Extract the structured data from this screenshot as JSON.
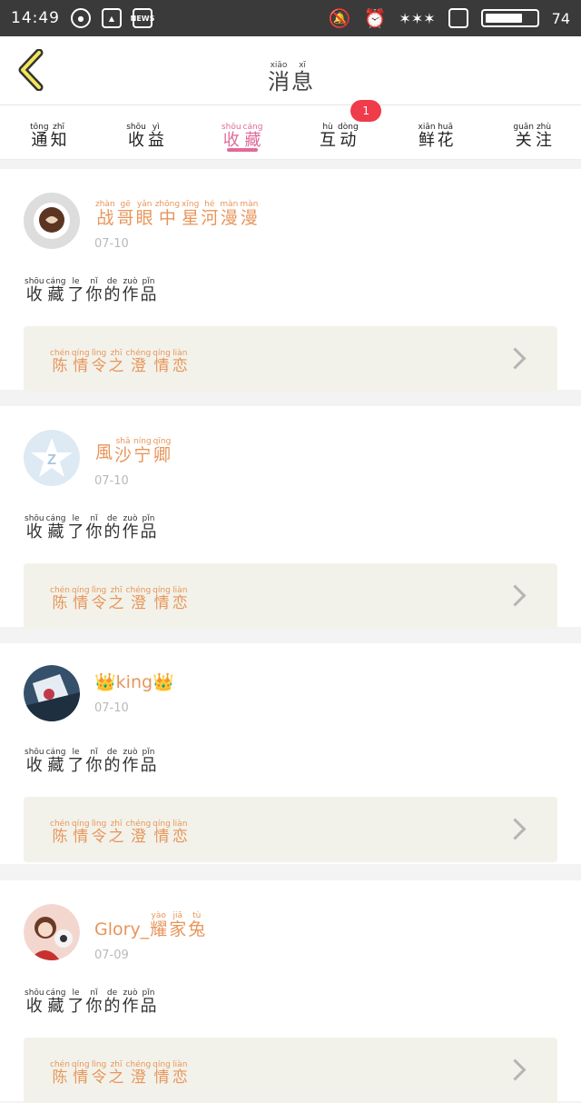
{
  "status_bar": {
    "time": "14:49",
    "battery_pct": "74",
    "battery_level": 0.74,
    "icons": [
      "qq-icon",
      "gallery-icon",
      "news-icon",
      "mute-icon",
      "alarm-icon",
      "weather-icon",
      "screen-icon",
      "battery-icon"
    ],
    "news_label": "NEWS"
  },
  "header": {
    "title": [
      {
        "py": "xiāo",
        "hz": "消"
      },
      {
        "py": "xī",
        "hz": "息"
      }
    ]
  },
  "tabs": [
    {
      "chars": [
        {
          "py": "tōng",
          "hz": "通"
        },
        {
          "py": "zhī",
          "hz": "知"
        }
      ]
    },
    {
      "chars": [
        {
          "py": "shōu",
          "hz": "收"
        },
        {
          "py": "yì",
          "hz": "益"
        }
      ]
    },
    {
      "chars": [
        {
          "py": "shōu",
          "hz": "收"
        },
        {
          "py": "cáng",
          "hz": "藏"
        }
      ],
      "active": true
    },
    {
      "chars": [
        {
          "py": "hù",
          "hz": "互"
        },
        {
          "py": "dòng",
          "hz": "动"
        }
      ],
      "badge": "1"
    },
    {
      "chars": [
        {
          "py": "xiān",
          "hz": "鲜"
        },
        {
          "py": "huā",
          "hz": "花"
        }
      ]
    },
    {
      "chars": [
        {
          "py": "guān",
          "hz": "关"
        },
        {
          "py": "zhù",
          "hz": "注"
        }
      ]
    }
  ],
  "action_text": [
    {
      "py": "shōu",
      "hz": "收"
    },
    {
      "py": "cáng",
      "hz": "藏"
    },
    {
      "py": "le",
      "hz": "了"
    },
    {
      "py": "nǐ",
      "hz": "你"
    },
    {
      "py": "de",
      "hz": "的"
    },
    {
      "py": "zuò",
      "hz": "作"
    },
    {
      "py": "pǐn",
      "hz": "品"
    }
  ],
  "work_title": [
    {
      "py": "chén",
      "hz": "陈"
    },
    {
      "py": "qíng",
      "hz": "情"
    },
    {
      "py": "lìng",
      "hz": "令"
    },
    {
      "py": "zhī",
      "hz": "之"
    },
    {
      "py": "chéng",
      "hz": "澄"
    },
    {
      "py": "qíng",
      "hz": "情"
    },
    {
      "py": "liàn",
      "hz": "恋"
    }
  ],
  "items": [
    {
      "user": [
        {
          "py": "zhàn",
          "hz": "战"
        },
        {
          "py": "gē",
          "hz": "哥"
        },
        {
          "py": "yǎn",
          "hz": "眼"
        },
        {
          "py": "zhōng",
          "hz": "中"
        },
        {
          "py": "xīng",
          "hz": "星"
        },
        {
          "py": "hé",
          "hz": "河"
        },
        {
          "py": "màn",
          "hz": "漫"
        },
        {
          "py": "màn",
          "hz": "漫"
        }
      ],
      "date": "07-10",
      "avatar": "coffee-avatar"
    },
    {
      "user": [
        {
          "py": "",
          "hz": "風"
        },
        {
          "py": "shā",
          "hz": "沙"
        },
        {
          "py": "níng",
          "hz": "宁"
        },
        {
          "py": "qīng",
          "hz": "卿"
        }
      ],
      "date": "07-10",
      "avatar": "default-avatar"
    },
    {
      "user_plain": "👑king👑",
      "date": "07-10",
      "avatar": "anime-avatar"
    },
    {
      "user_plain_prefix": "Glory_",
      "user": [
        {
          "py": "yào",
          "hz": "耀"
        },
        {
          "py": "jiā",
          "hz": "家"
        },
        {
          "py": "tù",
          "hz": "兔"
        }
      ],
      "date": "07-09",
      "avatar": "girl-avatar"
    }
  ]
}
